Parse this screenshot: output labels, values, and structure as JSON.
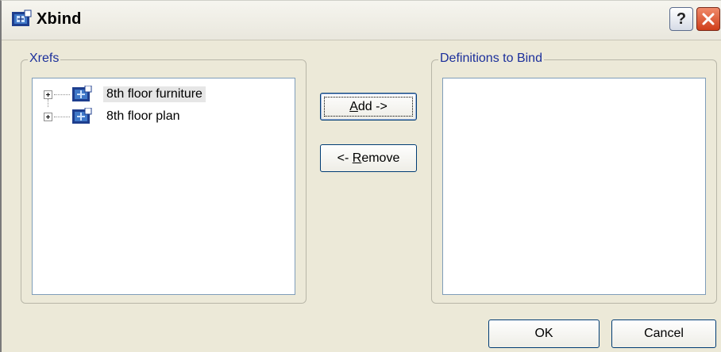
{
  "window": {
    "title": "Xbind",
    "help_label": "?"
  },
  "xrefs": {
    "label": "Xrefs",
    "items": [
      {
        "label": "8th floor furniture",
        "selected": true
      },
      {
        "label": "8th floor plan",
        "selected": false
      }
    ]
  },
  "definitions": {
    "label": "Definitions to Bind",
    "items": []
  },
  "buttons": {
    "add": {
      "mnemonic": "A",
      "rest": "dd ->"
    },
    "remove": {
      "prefix": "<- ",
      "mnemonic": "R",
      "rest": "emove"
    },
    "ok": "OK",
    "cancel": "Cancel"
  },
  "icons": {
    "title": "xref-drawing-icon",
    "item": "xref-drawing-icon",
    "help": "help-icon",
    "close": "close-icon",
    "expand": "plus-expander-icon"
  },
  "colors": {
    "accent": "#1b2f9b",
    "face": "#ece9d8",
    "border": "#7f9db9"
  }
}
